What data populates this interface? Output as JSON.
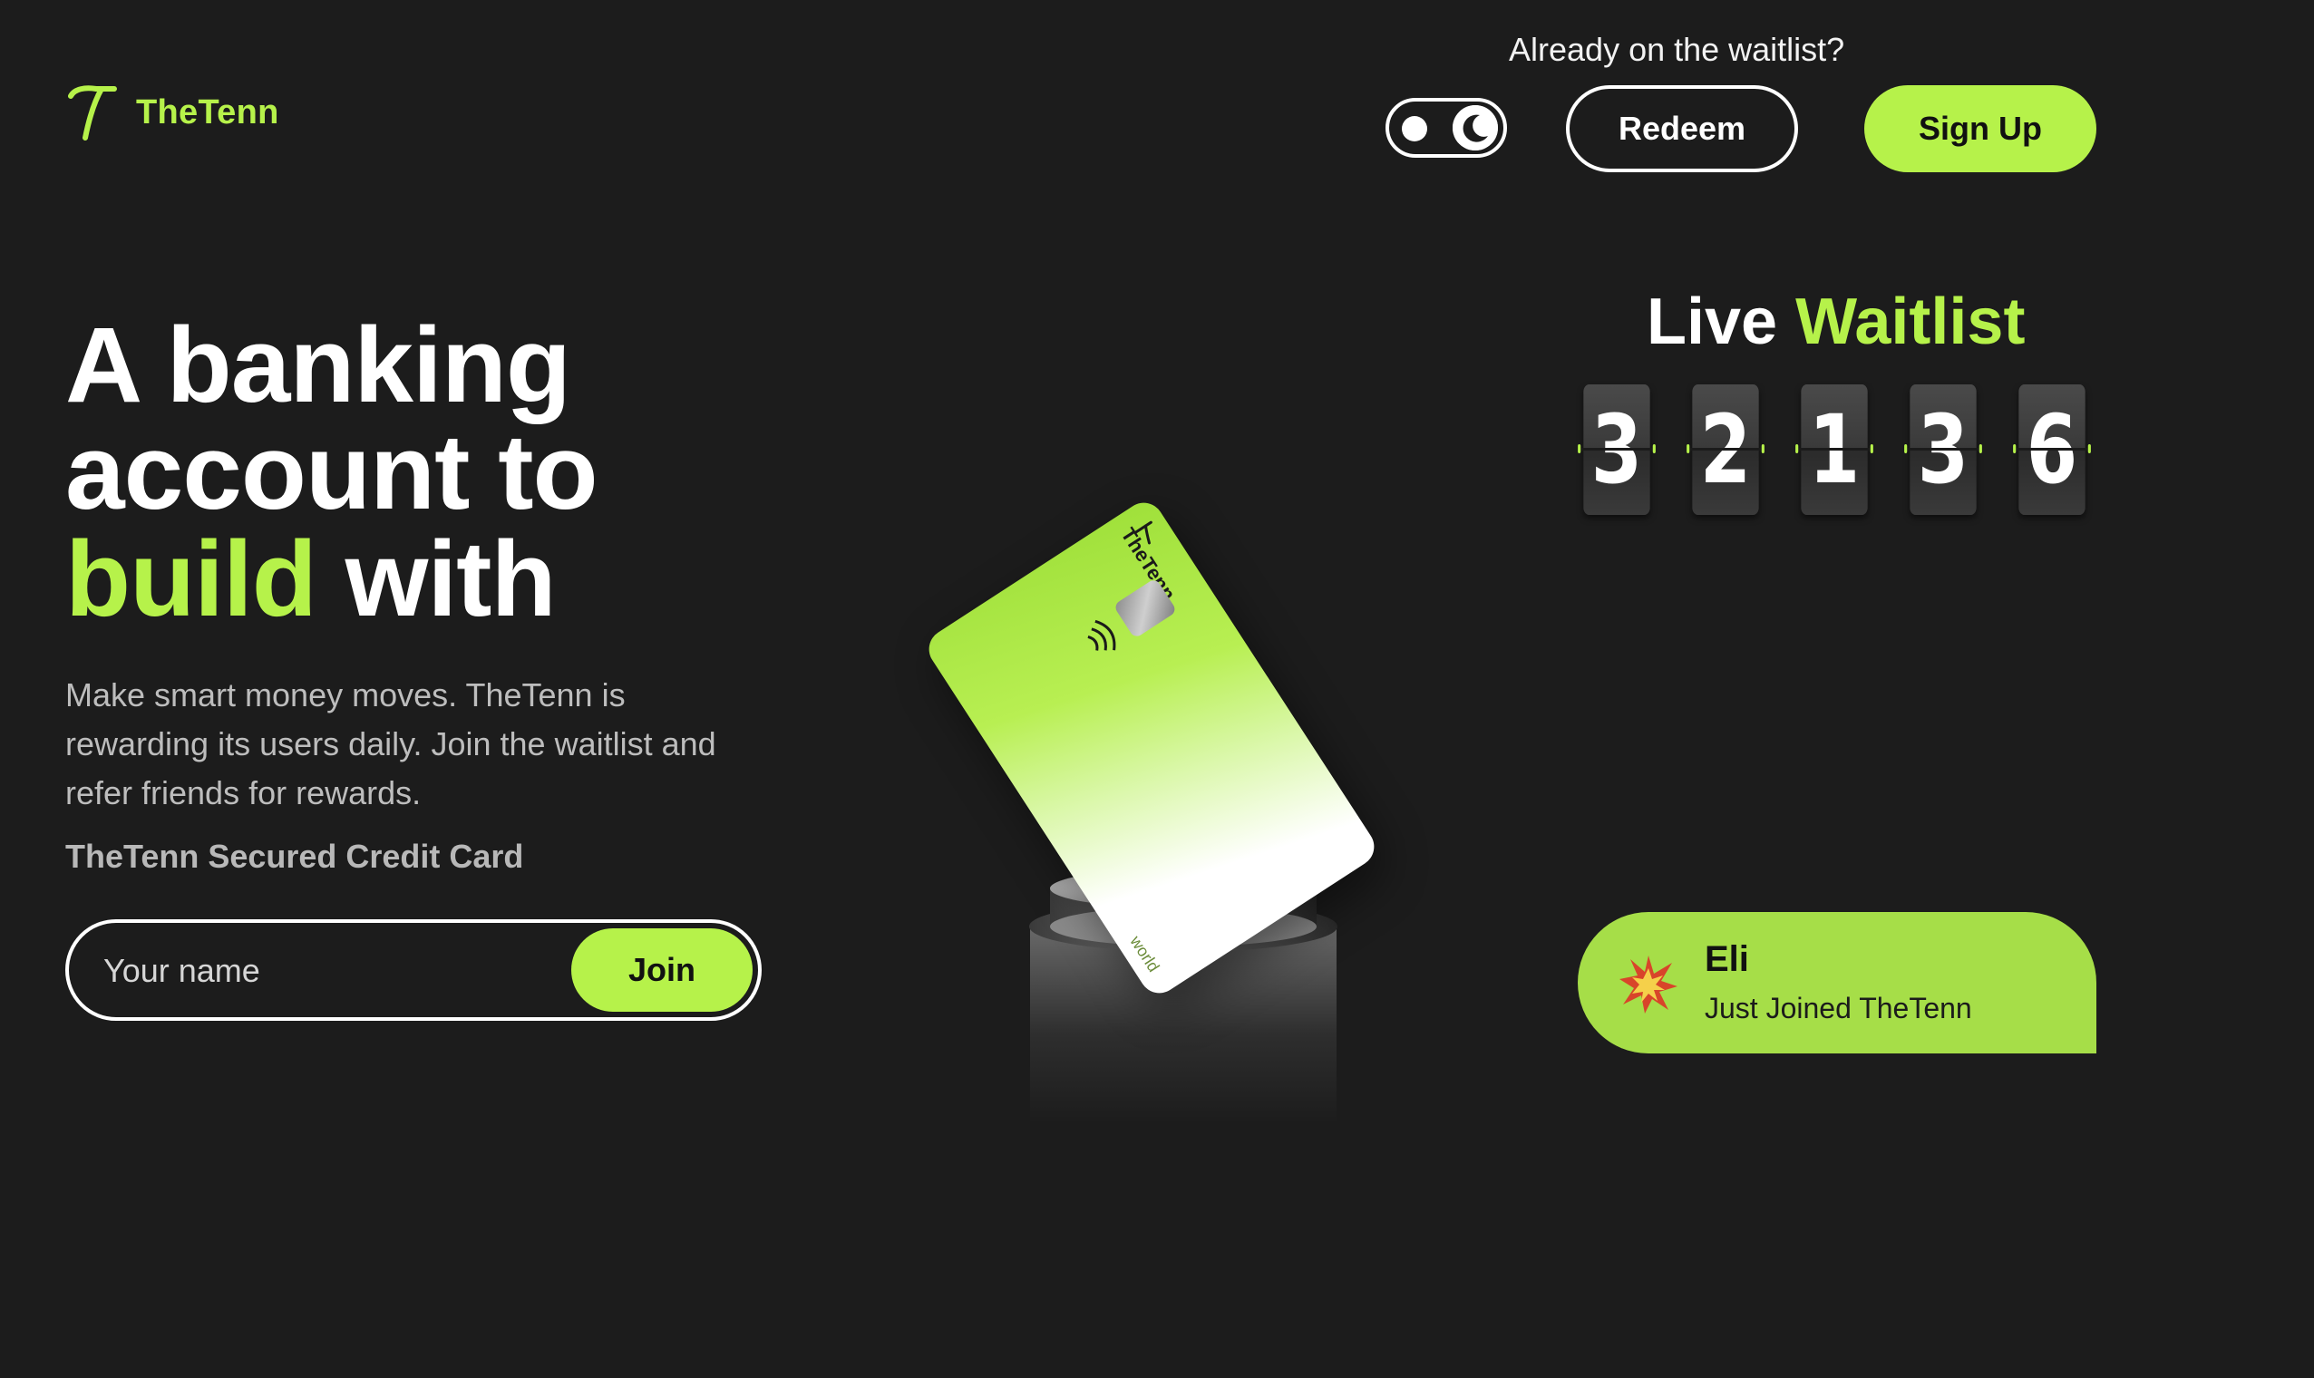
{
  "brand": {
    "name": "TheTenn",
    "accent_color": "#b6f24a",
    "background_color": "#1c1c1c",
    "logo_icon": "t-logo-icon"
  },
  "header": {
    "already_text": "Already on the waitlist?",
    "redeem_label": "Redeem",
    "signup_label": "Sign Up",
    "theme_toggle": {
      "icon": "moon-icon",
      "mode": "dark"
    }
  },
  "hero": {
    "headline_line1": "A banking",
    "headline_line2": "account to",
    "headline_accent": "build",
    "headline_end": " with",
    "subtext": "Make smart money moves. TheTenn is rewarding its users daily. Join the waitlist and refer friends for rewards.",
    "card_label": "TheTenn Secured Credit Card",
    "name_placeholder": "Your name",
    "join_label": "Join"
  },
  "card": {
    "brand": "TheTenn",
    "network": "world",
    "icons": [
      "chip-icon",
      "contactless-icon"
    ]
  },
  "waitlist": {
    "title_plain": "Live ",
    "title_accent": "Waitlist",
    "digits": [
      "3",
      "2",
      "1",
      "3",
      "6"
    ]
  },
  "notification": {
    "name": "Eli",
    "message": "Just Joined TheTenn",
    "icon": "burst-icon"
  }
}
